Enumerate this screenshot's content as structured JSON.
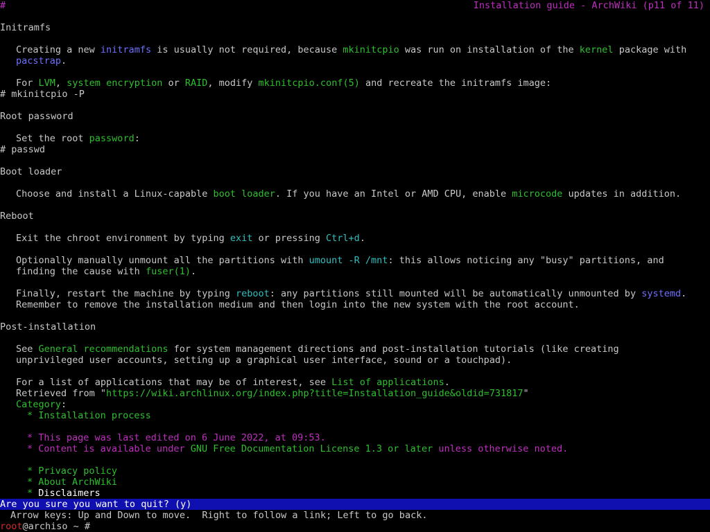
{
  "title_bar": {
    "hash": "#",
    "title": "Installation guide - ArchWiki (p11 of 11)"
  },
  "sections": {
    "initramfs": {
      "heading": "Initramfs",
      "p1_a": "Creating a new ",
      "p1_link1": "initramfs",
      "p1_b": " is usually not required, because ",
      "p1_link2": "mkinitcpio",
      "p1_c": " was run on installation of the ",
      "p1_link3": "kernel",
      "p1_d": " package with",
      "p1_link4": "pacstrap",
      "p1_e": ".",
      "p2_a": "For ",
      "p2_link1": "LVM",
      "p2_b": ", ",
      "p2_link2": "system encryption",
      "p2_c": " or ",
      "p2_link3": "RAID",
      "p2_d": ", modify ",
      "p2_link4": "mkinitcpio.conf(5)",
      "p2_e": " and recreate the initramfs image:",
      "cmd": "# mkinitcpio -P"
    },
    "root_password": {
      "heading": "Root password",
      "p1_a": "Set the root ",
      "p1_link": "password",
      "p1_b": ":",
      "cmd": "# passwd"
    },
    "boot_loader": {
      "heading": "Boot loader",
      "p1_a": "Choose and install a Linux-capable ",
      "p1_link1": "boot loader",
      "p1_b": ". If you have an Intel or AMD CPU, enable ",
      "p1_link2": "microcode",
      "p1_c": " updates in addition."
    },
    "reboot": {
      "heading": "Reboot",
      "p1_a": "Exit the chroot environment by typing ",
      "p1_link1": "exit",
      "p1_b": " or pressing ",
      "p1_link2": "Ctrl+d",
      "p1_c": ".",
      "p2_a": "Optionally manually unmount all the partitions with ",
      "p2_link1": "umount -R /mnt",
      "p2_b": ": this allows noticing any \"busy\" partitions, and",
      "p2_c": "finding the cause with ",
      "p2_link2": "fuser(1)",
      "p2_d": ".",
      "p3_a": "Finally, restart the machine by typing ",
      "p3_link1": "reboot",
      "p3_b": ": any partitions still mounted will be automatically unmounted by ",
      "p3_link2": "systemd",
      "p3_c": ".",
      "p3_d": "Remember to remove the installation medium and then login into the new system with the root account."
    },
    "post_installation": {
      "heading": "Post-installation",
      "p1_a": "See ",
      "p1_link": "General recommendations",
      "p1_b": " for system management directions and post-installation tutorials (like creating",
      "p1_c": "unprivileged user accounts, setting up a graphical user interface, sound or a touchpad).",
      "p2_a": "For a list of applications that may be of interest, see ",
      "p2_link": "List of applications",
      "p2_b": ".",
      "retrieved": "Retrieved from \"",
      "retrieved_link": "https://wiki.archlinux.org/index.php?title=Installation_guide&oldid=731817",
      "retrieved_end": "\"",
      "category_label": "Category",
      "category_colon": ":",
      "category_item": "* Installation process",
      "last_edited": "* This page was last edited on 6 June 2022, at 09:53.",
      "license_a": "* Content is available under ",
      "license_link": "GNU Free Documentation License 1.3 or later",
      "license_b": " unless otherwise noted.",
      "footer_items": [
        "* Privacy policy",
        "* About ArchWiki"
      ],
      "footer_selected": "* ",
      "footer_selected_label": "Disclaimers"
    }
  },
  "status": {
    "quit_prompt": "Are you sure you want to quit? (y)",
    "hint": "Arrow keys: Up and Down to move.  Right to follow a link; Left to go back."
  },
  "shell": {
    "user": "root",
    "rest": "@archiso ~ #"
  },
  "colors": {
    "link_green": "#2fbf2f",
    "link_blue": "#6f6fff",
    "link_cyan": "#2fbfbf",
    "accent_magenta": "#bf2fbf",
    "status_bar": "#1010b0",
    "prompt_user": "#d02a2a"
  }
}
